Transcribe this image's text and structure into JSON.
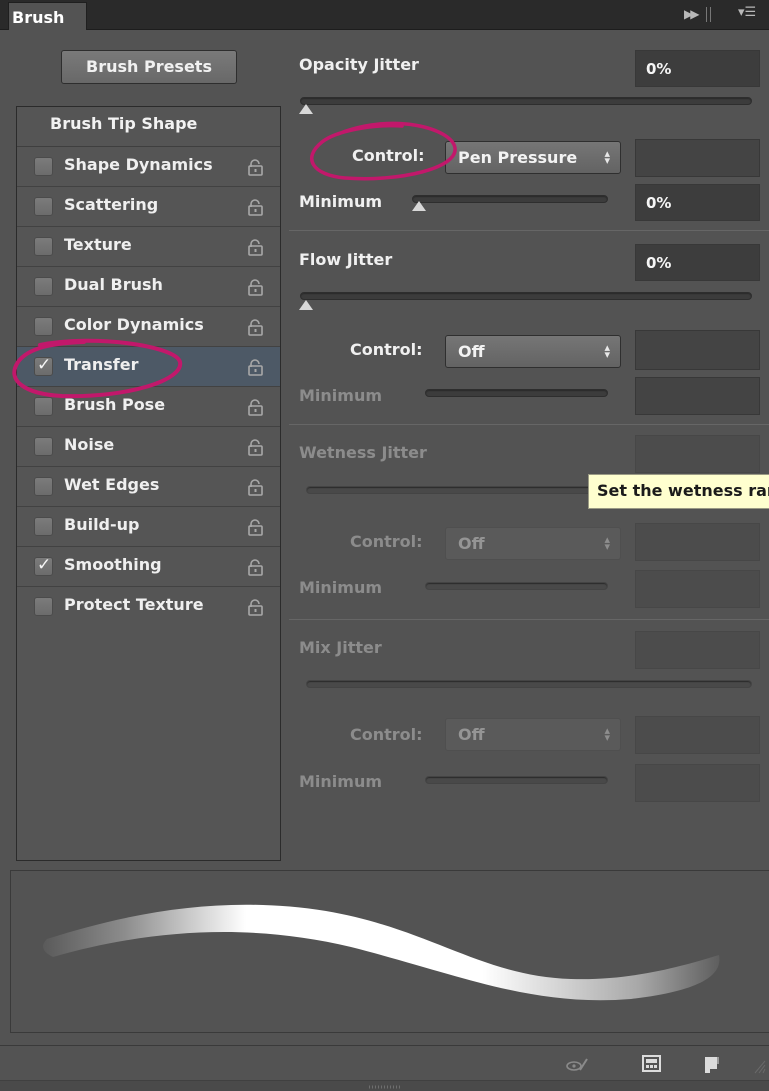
{
  "panel": {
    "tab_title": "Brush",
    "icons": [
      "collapse-double-arrow-icon",
      "panel-menu-icon"
    ]
  },
  "sidebar": {
    "presets_button": "Brush Presets",
    "tip_shape": "Brush Tip Shape",
    "items": [
      {
        "label": "Shape Dynamics",
        "checked": false,
        "selected": false,
        "icon": "lock-icon"
      },
      {
        "label": "Scattering",
        "checked": false,
        "selected": false,
        "icon": "lock-icon"
      },
      {
        "label": "Texture",
        "checked": false,
        "selected": false,
        "icon": "lock-icon"
      },
      {
        "label": "Dual Brush",
        "checked": false,
        "selected": false,
        "icon": "lock-icon"
      },
      {
        "label": "Color Dynamics",
        "checked": false,
        "selected": false,
        "icon": "lock-icon"
      },
      {
        "label": "Transfer",
        "checked": true,
        "selected": true,
        "icon": "lock-icon"
      },
      {
        "label": "Brush Pose",
        "checked": false,
        "selected": false,
        "icon": "lock-icon"
      },
      {
        "label": "Noise",
        "checked": false,
        "selected": false,
        "icon": "lock-icon"
      },
      {
        "label": "Wet Edges",
        "checked": false,
        "selected": false,
        "icon": "lock-icon"
      },
      {
        "label": "Build-up",
        "checked": false,
        "selected": false,
        "icon": "lock-icon"
      },
      {
        "label": "Smoothing",
        "checked": true,
        "selected": false,
        "icon": "lock-icon"
      },
      {
        "label": "Protect Texture",
        "checked": false,
        "selected": false,
        "icon": "lock-icon"
      }
    ]
  },
  "transfer": {
    "opacity": {
      "label": "Opacity Jitter",
      "value": "0%",
      "slider_level": 0,
      "control_label": "Control:",
      "control_value": "Pen Pressure",
      "control_field": "",
      "minimum_label": "Minimum",
      "minimum_value": "0%",
      "minimum_level": 0,
      "enabled": true
    },
    "flow": {
      "label": "Flow Jitter",
      "value": "0%",
      "slider_level": 0,
      "control_label": "Control:",
      "control_value": "Off",
      "control_field": "",
      "minimum_label": "Minimum",
      "minimum_value": "",
      "enabled": true
    },
    "wetness": {
      "label": "Wetness Jitter",
      "value": "",
      "control_label": "Control:",
      "control_value": "Off",
      "control_field": "",
      "minimum_label": "Minimum",
      "minimum_value": "",
      "enabled": false
    },
    "mix": {
      "label": "Mix Jitter",
      "value": "",
      "control_label": "Control:",
      "control_value": "Off",
      "control_field": "",
      "minimum_label": "Minimum",
      "minimum_value": "",
      "enabled": false
    }
  },
  "tooltip": "Set the wetness randomness",
  "annotation_color": "#c2186b",
  "selection_color": "#4d5966",
  "bottom_toolbar": {
    "icons": [
      "toggle-live-tip-brush-preview-icon",
      "open-preset-manager-icon",
      "create-new-brush-icon"
    ]
  }
}
